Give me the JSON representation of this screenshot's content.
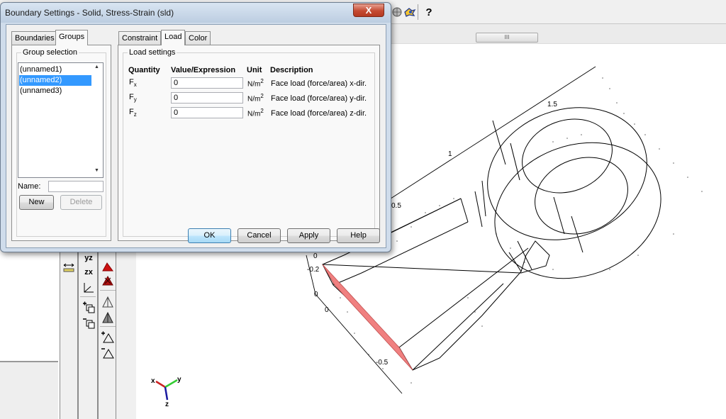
{
  "toolbar": {
    "icons": [
      "globe-icon",
      "palette-icon",
      "help-icon"
    ],
    "help_glyph": "?",
    "scroll_thumb_glyph": "III"
  },
  "dialog": {
    "title": "Boundary Settings - Solid, Stress-Strain (sld)",
    "close_label": "X",
    "left_tabs": [
      {
        "label": "Boundaries",
        "active": false
      },
      {
        "label": "Groups",
        "active": true
      }
    ],
    "right_tabs": [
      {
        "label": "Constraint",
        "active": false
      },
      {
        "label": "Load",
        "active": true
      },
      {
        "label": "Color",
        "active": false
      }
    ],
    "group_selection": {
      "label": "Group selection",
      "items": [
        {
          "label": "(unnamed1)",
          "selected": false
        },
        {
          "label": "(unnamed2)",
          "selected": true
        },
        {
          "label": "(unnamed3)",
          "selected": false
        }
      ],
      "name_label": "Name:",
      "name_value": "",
      "new_label": "New",
      "delete_label": "Delete"
    },
    "load_settings": {
      "label": "Load settings",
      "headers": {
        "quantity": "Quantity",
        "value": "Value/Expression",
        "unit": "Unit",
        "description": "Description"
      },
      "rows": [
        {
          "quantity": "F",
          "sub": "x",
          "value": "0",
          "unit": "N/m",
          "unit_exp": "2",
          "description": "Face load (force/area) x-dir."
        },
        {
          "quantity": "F",
          "sub": "y",
          "value": "0",
          "unit": "N/m",
          "unit_exp": "2",
          "description": "Face load (force/area) y-dir."
        },
        {
          "quantity": "F",
          "sub": "z",
          "value": "0",
          "unit": "N/m",
          "unit_exp": "2",
          "description": "Face load (force/area) z-dir."
        }
      ]
    },
    "buttons": {
      "ok": "OK",
      "cancel": "Cancel",
      "apply": "Apply",
      "help": "Help"
    }
  },
  "vertical_toolbars": {
    "tb2_labels": {
      "yz": "yz",
      "zx": "zx"
    }
  },
  "viewport": {
    "axis_labels": [
      "1.5",
      "1",
      "0.5",
      "0",
      "-0.2",
      "0",
      "0",
      "-0.5"
    ],
    "axis_indicator": {
      "x": "x",
      "y": "y",
      "z": "z"
    },
    "selected_face_color": "#f08080"
  }
}
